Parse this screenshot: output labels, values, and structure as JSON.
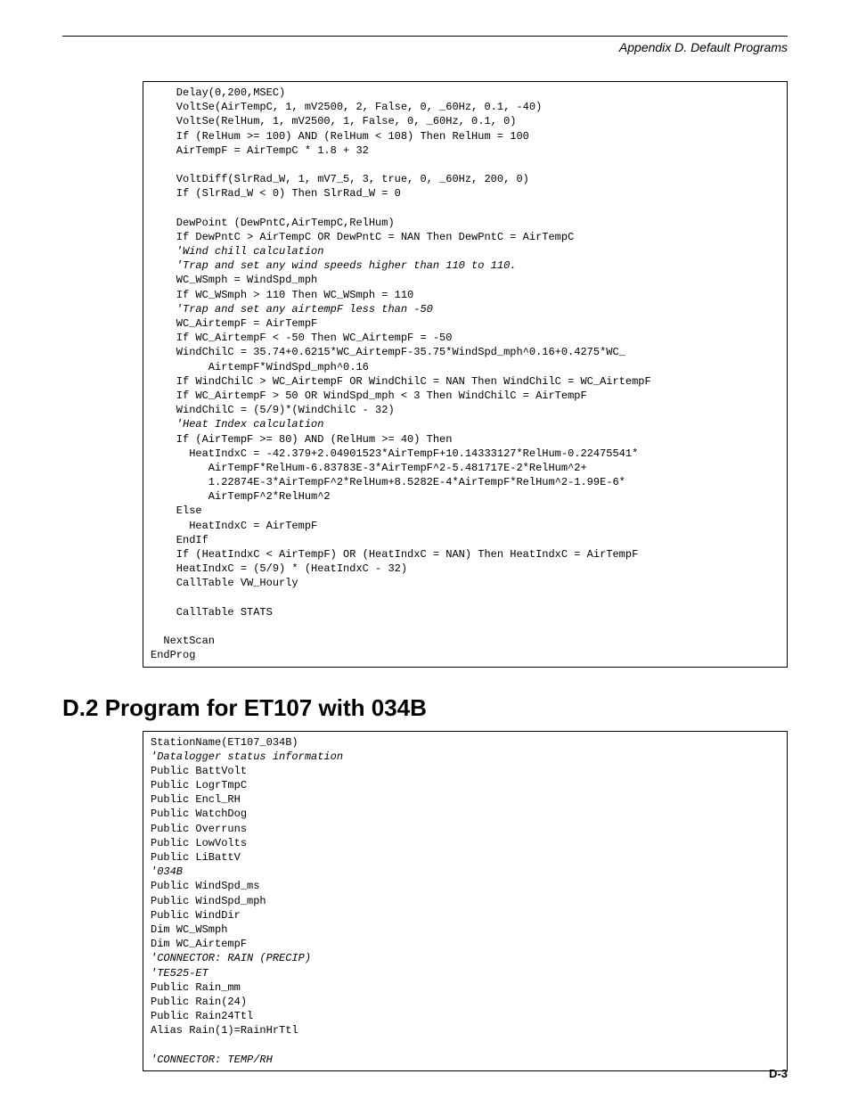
{
  "header": {
    "running": "Appendix D.  Default Programs"
  },
  "code1": {
    "lines": [
      {
        "t": "    Delay(0,200,MSEC)"
      },
      {
        "t": "    VoltSe(AirTempC, 1, mV2500, 2, False, 0, _60Hz, 0.1, -40)"
      },
      {
        "t": "    VoltSe(RelHum, 1, mV2500, 1, False, 0, _60Hz, 0.1, 0)"
      },
      {
        "t": "    If (RelHum >= 100) AND (RelHum < 108) Then RelHum = 100"
      },
      {
        "t": "    AirTempF = AirTempC * 1.8 + 32"
      },
      {
        "t": ""
      },
      {
        "t": "    VoltDiff(SlrRad_W, 1, mV7_5, 3, true, 0, _60Hz, 200, 0)"
      },
      {
        "t": "    If (SlrRad_W < 0) Then SlrRad_W = 0"
      },
      {
        "t": ""
      },
      {
        "t": "    DewPoint (DewPntC,AirTempC,RelHum)"
      },
      {
        "t": "    If DewPntC > AirTempC OR DewPntC = NAN Then DewPntC = AirTempC"
      },
      {
        "t": "    'Wind chill calculation",
        "c": true
      },
      {
        "t": "    'Trap and set any wind speeds higher than 110 to 110.",
        "c": true
      },
      {
        "t": "    WC_WSmph = WindSpd_mph"
      },
      {
        "t": "    If WC_WSmph > 110 Then WC_WSmph = 110"
      },
      {
        "t": "    'Trap and set any airtempF less than -50",
        "c": true
      },
      {
        "t": "    WC_AirtempF = AirTempF"
      },
      {
        "t": "    If WC_AirtempF < -50 Then WC_AirtempF = -50"
      },
      {
        "t": "    WindChilC = 35.74+0.6215*WC_AirtempF-35.75*WindSpd_mph^0.16+0.4275*WC_"
      },
      {
        "t": "         AirtempF*WindSpd_mph^0.16"
      },
      {
        "t": "    If WindChilC > WC_AirtempF OR WindChilC = NAN Then WindChilC = WC_AirtempF"
      },
      {
        "t": "    If WC_AirtempF > 50 OR WindSpd_mph < 3 Then WindChilC = AirTempF"
      },
      {
        "t": "    WindChilC = (5/9)*(WindChilC - 32)"
      },
      {
        "t": "    'Heat Index calculation",
        "c": true
      },
      {
        "t": "    If (AirTempF >= 80) AND (RelHum >= 40) Then"
      },
      {
        "t": "      HeatIndxC = -42.379+2.04901523*AirTempF+10.14333127*RelHum-0.22475541*"
      },
      {
        "t": "         AirTempF*RelHum-6.83783E-3*AirTempF^2-5.481717E-2*RelHum^2+"
      },
      {
        "t": "         1.22874E-3*AirTempF^2*RelHum+8.5282E-4*AirTempF*RelHum^2-1.99E-6*"
      },
      {
        "t": "         AirTempF^2*RelHum^2"
      },
      {
        "t": "    Else"
      },
      {
        "t": "      HeatIndxC = AirTempF"
      },
      {
        "t": "    EndIf"
      },
      {
        "t": "    If (HeatIndxC < AirTempF) OR (HeatIndxC = NAN) Then HeatIndxC = AirTempF"
      },
      {
        "t": "    HeatIndxC = (5/9) * (HeatIndxC - 32)"
      },
      {
        "t": "    CallTable VW_Hourly"
      },
      {
        "t": ""
      },
      {
        "t": "    CallTable STATS"
      },
      {
        "t": ""
      },
      {
        "t": "  NextScan"
      },
      {
        "t": "EndProg"
      }
    ]
  },
  "section": {
    "number": "D.2",
    "title": "Program for ET107 with 034B"
  },
  "code2": {
    "lines": [
      {
        "t": "StationName(ET107_034B)"
      },
      {
        "t": "'Datalogger status information",
        "c": true
      },
      {
        "t": "Public BattVolt"
      },
      {
        "t": "Public LogrTmpC"
      },
      {
        "t": "Public Encl_RH"
      },
      {
        "t": "Public WatchDog"
      },
      {
        "t": "Public Overruns"
      },
      {
        "t": "Public LowVolts"
      },
      {
        "t": "Public LiBattV"
      },
      {
        "t": "'034B",
        "c": true
      },
      {
        "t": "Public WindSpd_ms"
      },
      {
        "t": "Public WindSpd_mph"
      },
      {
        "t": "Public WindDir"
      },
      {
        "t": "Dim WC_WSmph"
      },
      {
        "t": "Dim WC_AirtempF"
      },
      {
        "t": "'CONNECTOR: RAIN (PRECIP)",
        "c": true
      },
      {
        "t": "'TE525-ET",
        "c": true
      },
      {
        "t": "Public Rain_mm"
      },
      {
        "t": "Public Rain(24)"
      },
      {
        "t": "Public Rain24Ttl"
      },
      {
        "t": "Alias Rain(1)=RainHrTtl"
      },
      {
        "t": ""
      },
      {
        "t": "'CONNECTOR: TEMP/RH",
        "c": true
      }
    ]
  },
  "footer": {
    "page": "D-3"
  }
}
